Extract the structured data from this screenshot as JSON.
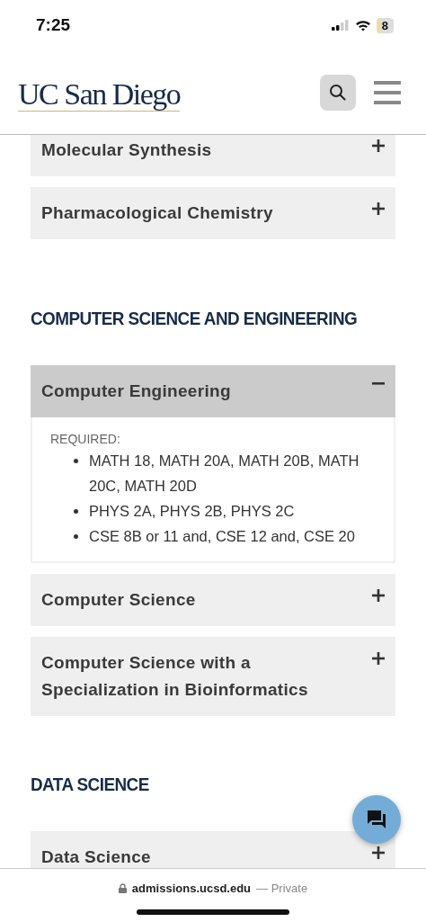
{
  "status_bar": {
    "time": "7:25",
    "battery": "8"
  },
  "header": {
    "logo": "UC San Diego"
  },
  "sections": [
    {
      "items": [
        {
          "title": "Molecular Synthesis",
          "expanded": false
        },
        {
          "title": "Pharmacological Chemistry",
          "expanded": false
        }
      ]
    },
    {
      "heading": "COMPUTER SCIENCE AND ENGINEERING",
      "items": [
        {
          "title": "Computer Engineering",
          "expanded": true,
          "body": {
            "label": "REQUIRED:",
            "bullets": [
              "MATH 18, MATH 20A, MATH 20B, MATH 20C, MATH 20D",
              "PHYS 2A, PHYS 2B, PHYS 2C",
              "CSE 8B or 11 and, CSE 12 and, CSE 20"
            ]
          }
        },
        {
          "title": "Computer Science",
          "expanded": false
        },
        {
          "title": "Computer Science with a Specialization in Bioinformatics",
          "expanded": false
        }
      ]
    },
    {
      "heading": "DATA SCIENCE",
      "items": [
        {
          "title": "Data Science",
          "expanded": false
        }
      ]
    }
  ],
  "address_bar": {
    "domain": "admissions.ucsd.edu",
    "note": "— Private"
  }
}
